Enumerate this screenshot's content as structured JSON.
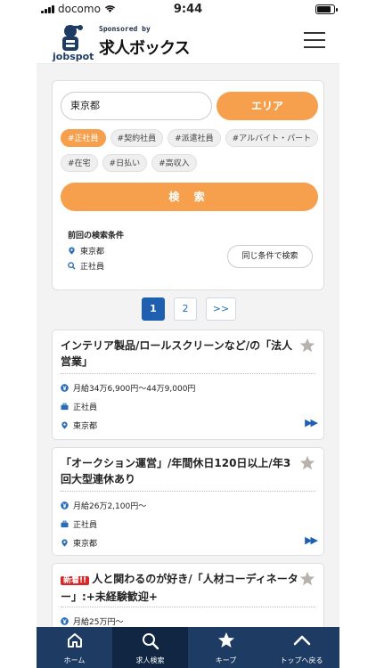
{
  "status_bar": {
    "carrier": "docomo",
    "time": "9:44"
  },
  "header": {
    "logo_text": "jobspot",
    "sponsor_text": "Sponsored by",
    "brand_text": "求人ボックス",
    "menu_icon": "hamburger-icon"
  },
  "search": {
    "location_value": "東京都",
    "area_button": "エリア",
    "tags": [
      {
        "label": "#正社員",
        "active": true
      },
      {
        "label": "#契約社員",
        "active": false
      },
      {
        "label": "#派遣社員",
        "active": false
      },
      {
        "label": "#アルバイト・パート",
        "active": false
      },
      {
        "label": "#在宅",
        "active": false
      },
      {
        "label": "#日払い",
        "active": false
      },
      {
        "label": "#高収入",
        "active": false
      }
    ],
    "search_button": "検 索",
    "previous_label": "前回の検索条件",
    "previous_location": "東京都",
    "previous_keyword": "正社員",
    "same_condition_button": "同じ条件で検索"
  },
  "pagination": {
    "pages": [
      "1",
      "2"
    ],
    "current": "1",
    "next_label": ">>"
  },
  "jobs": [
    {
      "title": "インテリア製品/ロールスクリーンなど/の「法人営業」",
      "is_new": false,
      "salary": "月給34万6,900円〜44万9,000円",
      "employment": "正社員",
      "location": "東京都"
    },
    {
      "title": "「オークション運営」/年間休日120日以上/年3回大型連休あり",
      "is_new": false,
      "salary": "月給26万2,100円〜",
      "employment": "正社員",
      "location": "東京都"
    },
    {
      "title": "人と関わるのが好き/「人材コーディネーター」:+未経験歓迎+",
      "is_new": true,
      "new_label": "新着!!",
      "salary": "月給25万円〜",
      "employment": "",
      "location": ""
    }
  ],
  "bottom_nav": [
    {
      "label": "ホーム",
      "icon": "home-icon",
      "active": false
    },
    {
      "label": "求人検索",
      "icon": "search-icon",
      "active": true
    },
    {
      "label": "キープ",
      "icon": "star-icon",
      "active": false
    },
    {
      "label": "トップへ戻る",
      "icon": "chevron-up-icon",
      "active": false
    }
  ],
  "colors": {
    "accent": "#f6a04d",
    "navy": "#1e3b63",
    "link_blue": "#1f5fb0"
  }
}
